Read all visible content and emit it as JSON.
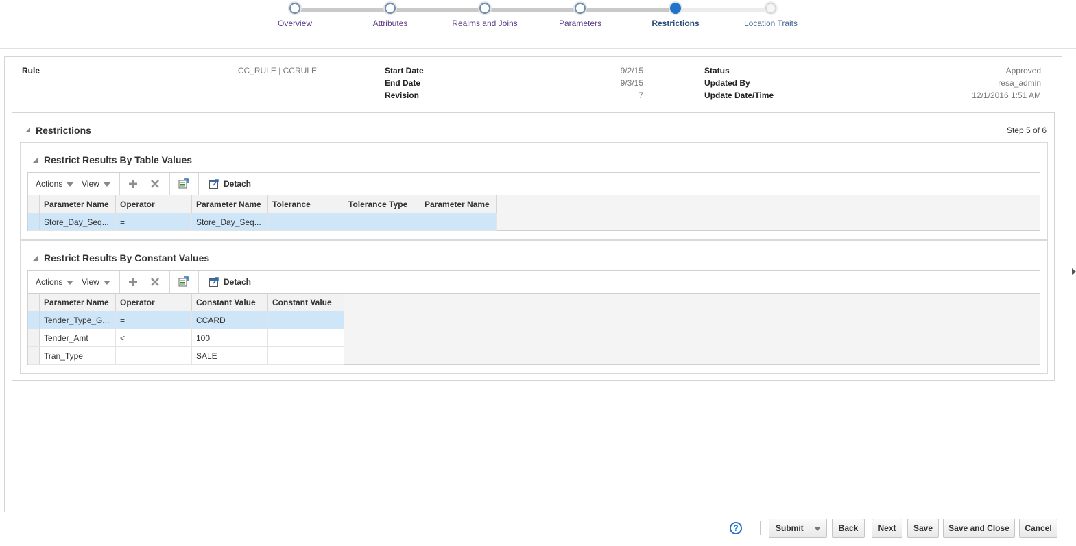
{
  "train": {
    "steps": [
      {
        "label": "Overview",
        "state": "visited"
      },
      {
        "label": "Attributes",
        "state": "visited"
      },
      {
        "label": "Realms and Joins",
        "state": "visited"
      },
      {
        "label": "Parameters",
        "state": "visited"
      },
      {
        "label": "Restrictions",
        "state": "current"
      },
      {
        "label": "Location Traits",
        "state": "future"
      }
    ]
  },
  "header": {
    "rule_label": "Rule",
    "rule_value": "CC_RULE | CCRULE",
    "start_date_label": "Start Date",
    "start_date_value": "9/2/15",
    "end_date_label": "End Date",
    "end_date_value": "9/3/15",
    "revision_label": "Revision",
    "revision_value": "7",
    "status_label": "Status",
    "status_value": "Approved",
    "updated_by_label": "Updated By",
    "updated_by_value": "resa_admin",
    "update_datetime_label": "Update Date/Time",
    "update_datetime_value": "12/1/2016 1:51 AM"
  },
  "restrictions": {
    "title": "Restrictions",
    "step_text": "Step 5 of 6",
    "table_values": {
      "title": "Restrict Results By Table Values",
      "toolbar": {
        "actions": "Actions",
        "view": "View",
        "detach": "Detach"
      },
      "columns": [
        "Parameter Name",
        "Operator",
        "Parameter Name",
        "Tolerance",
        "Tolerance Type",
        "Parameter Name"
      ],
      "rows": [
        [
          "Store_Day_Seq...",
          "=",
          "Store_Day_Seq...",
          "",
          "",
          ""
        ]
      ]
    },
    "constant_values": {
      "title": "Restrict Results By Constant Values",
      "toolbar": {
        "actions": "Actions",
        "view": "View",
        "detach": "Detach"
      },
      "columns": [
        "Parameter Name",
        "Operator",
        "Constant Value",
        "Constant Value"
      ],
      "rows": [
        [
          "Tender_Type_G...",
          "=",
          "CCARD",
          ""
        ],
        [
          "Tender_Amt",
          "<",
          "100",
          ""
        ],
        [
          "Tran_Type",
          "=",
          "SALE",
          ""
        ]
      ]
    }
  },
  "footer": {
    "help": "?",
    "submit": "Submit",
    "back": "Back",
    "next": "Next",
    "save": "Save",
    "save_and_close": "Save and Close",
    "cancel": "Cancel"
  },
  "colors": {
    "accent": "#1f74c9",
    "selected_row": "#cfe5f8",
    "train_visited_label": "#5b3a86"
  }
}
